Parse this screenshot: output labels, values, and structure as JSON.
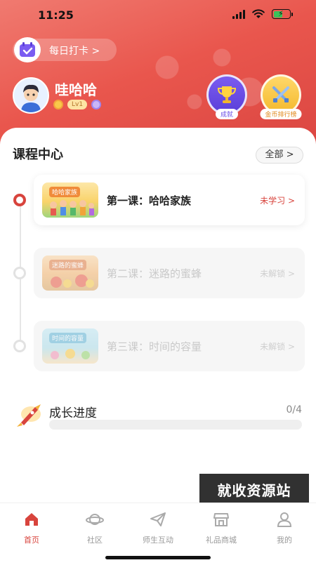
{
  "status_bar": {
    "time": "11:25"
  },
  "header": {
    "checkin_label": "每日打卡 >",
    "username": "哇哈哈",
    "level_badge": "Lv1",
    "achievement_label": "成就",
    "rank_label": "金币排行榜",
    "accent_color": "#e9564d"
  },
  "courses": {
    "title": "课程中心",
    "all_label": "全部 >",
    "lessons": [
      {
        "thumb_title": "哈哈家族",
        "title": "第一课：哈哈家族",
        "status": "未学习 >",
        "state": "active"
      },
      {
        "thumb_title": "迷路的蜜蜂",
        "title": "第二课：迷路的蜜蜂",
        "status": "未解锁 >",
        "state": "locked"
      },
      {
        "thumb_title": "时间的容量",
        "title": "第三课：时间的容量",
        "status": "未解锁 >",
        "state": "locked"
      }
    ]
  },
  "growth": {
    "title": "成长进度",
    "count": "0/4",
    "progress": 0
  },
  "watermark": "就收资源站",
  "tabbar": [
    {
      "label": "首页",
      "icon": "home-icon",
      "active": true
    },
    {
      "label": "社区",
      "icon": "planet-icon",
      "active": false
    },
    {
      "label": "师生互动",
      "icon": "send-icon",
      "active": false
    },
    {
      "label": "礼品商城",
      "icon": "store-icon",
      "active": false
    },
    {
      "label": "我的",
      "icon": "user-icon",
      "active": false
    }
  ]
}
